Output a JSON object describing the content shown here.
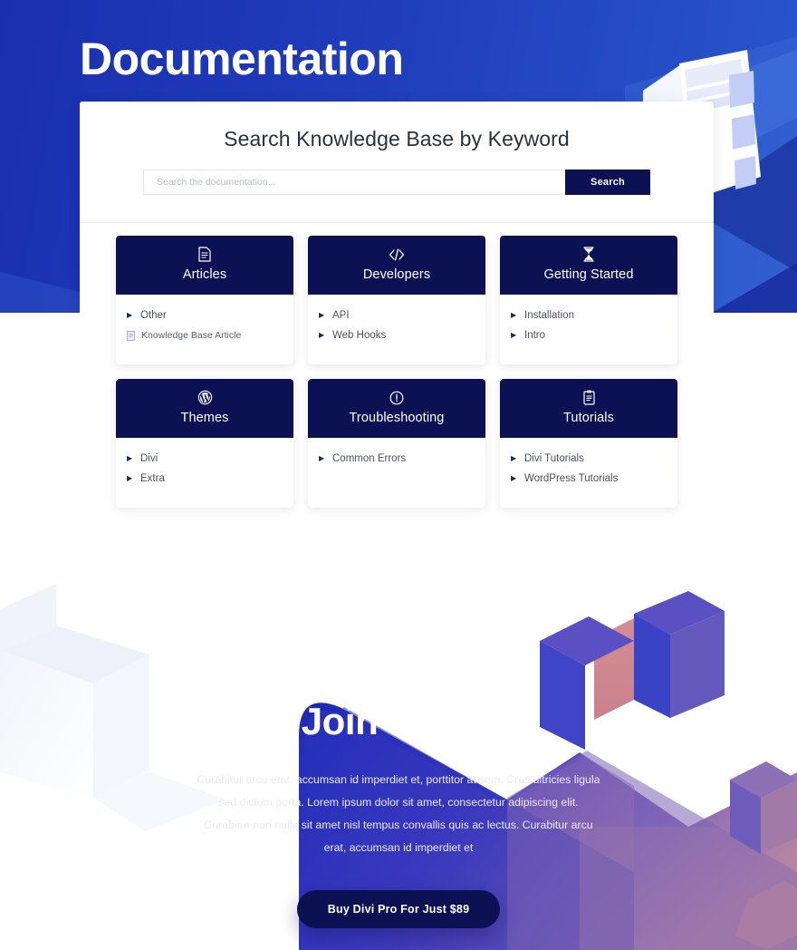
{
  "hero": {
    "title": "Documentation",
    "accent_blue": "#1f3cbb",
    "navy": "#0c1153"
  },
  "search": {
    "heading": "Search Knowledge Base by Keyword",
    "placeholder": "Search the documentation...",
    "value": "",
    "button_label": "Search"
  },
  "cards": [
    {
      "title": "Articles",
      "icon": "document-icon",
      "items": [
        {
          "label": "Other",
          "icon": "triangle-bullet-icon",
          "type": "category"
        },
        {
          "label": "Knowledge Base Article",
          "icon": "document-mini-icon",
          "type": "article"
        }
      ]
    },
    {
      "title": "Developers",
      "icon": "code-icon",
      "items": [
        {
          "label": "API",
          "icon": "triangle-bullet-icon",
          "type": "category"
        },
        {
          "label": "Web Hooks",
          "icon": "triangle-bullet-icon",
          "type": "category"
        }
      ]
    },
    {
      "title": "Getting Started",
      "icon": "hourglass-icon",
      "items": [
        {
          "label": "Installation",
          "icon": "triangle-bullet-icon",
          "type": "category"
        },
        {
          "label": "Intro",
          "icon": "triangle-bullet-icon",
          "type": "category"
        }
      ]
    },
    {
      "title": "Themes",
      "icon": "wordpress-icon",
      "items": [
        {
          "label": "Divi",
          "icon": "triangle-bullet-icon",
          "type": "category"
        },
        {
          "label": "Extra",
          "icon": "triangle-bullet-icon",
          "type": "category"
        }
      ]
    },
    {
      "title": "Troubleshooting",
      "icon": "exclamation-circle-icon",
      "items": [
        {
          "label": "Common Errors",
          "icon": "triangle-bullet-icon",
          "type": "category"
        }
      ]
    },
    {
      "title": "Tutorials",
      "icon": "clipboard-icon",
      "items": [
        {
          "label": "Divi Tutorials",
          "icon": "triangle-bullet-icon",
          "type": "category"
        },
        {
          "label": "WordPress Tutorials",
          "icon": "triangle-bullet-icon",
          "type": "category"
        }
      ]
    }
  ],
  "cta": {
    "title": "Join Today",
    "body": "Curabitur arcu erat, accumsan id imperdiet et, porttitor at sem. Cras ultricies ligula sed dictum porta. Lorem ipsum dolor sit amet, consectetur adipiscing elit. Curabitur non nulla sit amet nisl tempus convallis quis ac lectus. Curabitur arcu erat, accumsan id imperdiet et",
    "button_label": "Buy Divi Pro For Just $89"
  }
}
